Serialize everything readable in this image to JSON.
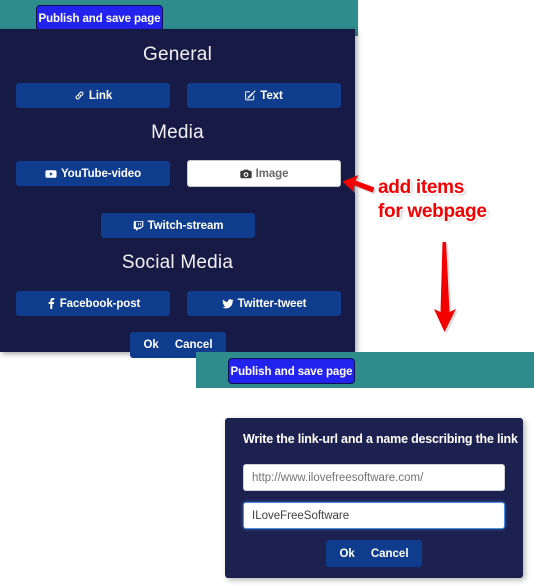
{
  "colors": {
    "teal_bar": "#2e8c8c",
    "panel_navy": "#181a46",
    "dialog_navy": "#1d2150",
    "button_blue": "#0f3c8c",
    "publish_blue": "#2323f0",
    "annotation_red": "#f40000",
    "focus_blue": "#4a90e2"
  },
  "top_window": {
    "publish_button": "Publish and save page",
    "sections": [
      {
        "title": "General",
        "buttons": [
          {
            "label": "Link",
            "icon": "link-icon",
            "state": "normal"
          },
          {
            "label": "Text",
            "icon": "pencil-square-icon",
            "state": "normal"
          }
        ]
      },
      {
        "title": "Media",
        "buttons": [
          {
            "label": "YouTube-video",
            "icon": "youtube-icon",
            "state": "normal"
          },
          {
            "label": "Image",
            "icon": "camera-icon",
            "state": "highlighted"
          },
          {
            "label": "Twitch-stream",
            "icon": "twitch-icon",
            "state": "normal"
          }
        ]
      },
      {
        "title": "Social Media",
        "buttons": [
          {
            "label": "Facebook-post",
            "icon": "facebook-icon",
            "state": "normal"
          },
          {
            "label": "Twitter-tweet",
            "icon": "twitter-icon",
            "state": "normal"
          }
        ]
      }
    ],
    "ok_label": "Ok",
    "cancel_label": "Cancel"
  },
  "annotation": {
    "line1": "add items",
    "line2": "for webpage",
    "arrow_left": "arrow-pointing-left",
    "arrow_down": "arrow-pointing-down"
  },
  "bottom_window": {
    "publish_button": "Publish and save page",
    "dialog": {
      "title": "Write the link-url and a name describing the link",
      "url_field": {
        "value": "http://www.ilovefreesoftware.com/",
        "placeholder": "http://www.ilovefreesoftware.com/"
      },
      "name_field": {
        "value": "ILoveFreeSoftware",
        "placeholder": "ILoveFreeSoftware"
      },
      "ok_label": "Ok",
      "cancel_label": "Cancel"
    }
  }
}
